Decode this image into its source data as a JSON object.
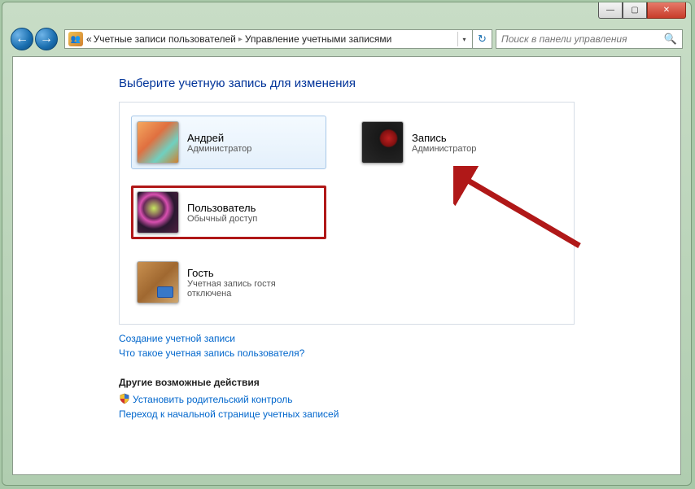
{
  "window": {
    "minimize": "—",
    "maximize": "▢",
    "close": "✕"
  },
  "nav": {
    "back_glyph": "←",
    "fwd_glyph": "→",
    "chevrons": "«",
    "crumb1": "Учетные записи пользователей",
    "crumb2": "Управление учетными записями",
    "sep": "▸",
    "refresh": "↻"
  },
  "search": {
    "placeholder": "Поиск в панели управления",
    "icon": "🔍"
  },
  "page": {
    "title": "Выберите учетную запись для изменения"
  },
  "accounts": [
    {
      "name": "Андрей",
      "role": "Администратор"
    },
    {
      "name": "Запись",
      "role": "Администратор"
    },
    {
      "name": "Пользователь",
      "role": "Обычный доступ"
    },
    {
      "name": "Гость",
      "role": "Учетная запись гостя отключена"
    }
  ],
  "links": {
    "create": "Создание учетной записи",
    "what_is": "Что такое учетная запись пользователя?",
    "other_header": "Другие возможные действия",
    "parental": "Установить родительский контроль",
    "goto_main": "Переход к начальной странице учетных записей"
  }
}
